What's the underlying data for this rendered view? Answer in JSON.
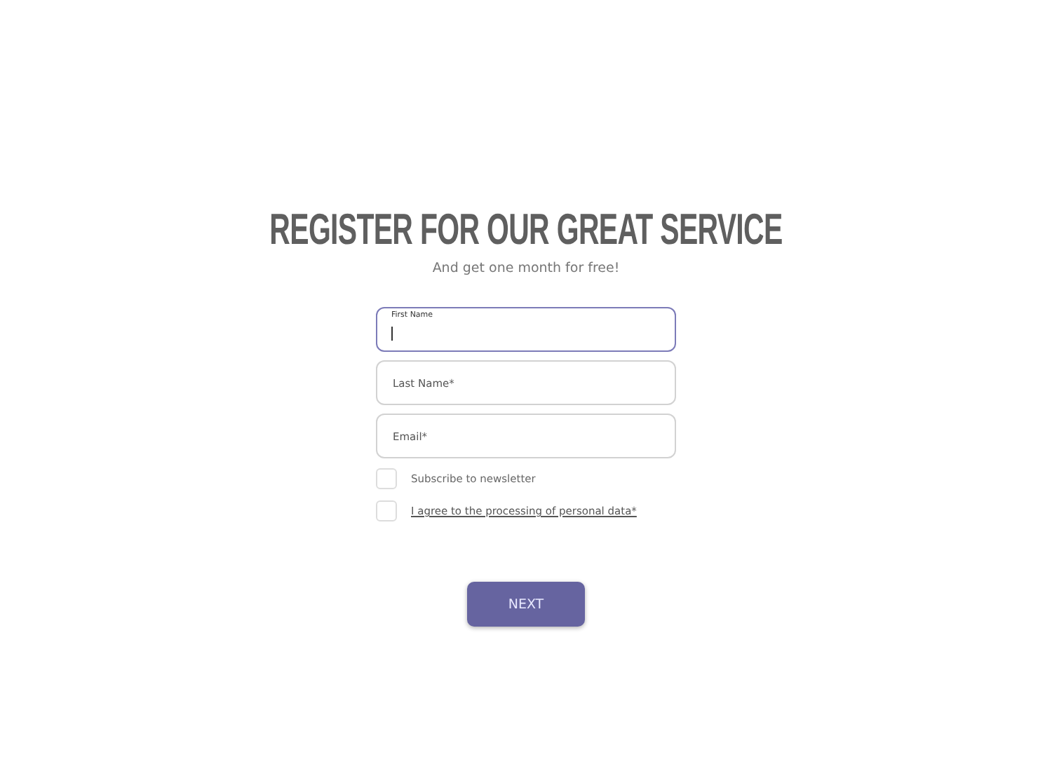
{
  "title": "REGISTER FOR OUR GREAT SERVICE",
  "subtitle": "And get one month for free!",
  "fields": [
    {
      "placeholder": "First Name",
      "focused": true
    },
    {
      "placeholder": "Last Name*",
      "focused": false
    },
    {
      "placeholder": "Email*",
      "focused": false
    }
  ],
  "checkboxes": [
    {
      "label": "Subscribe to newsletter",
      "checked": false,
      "kind": "text"
    },
    {
      "label": "I agree to the processing of personal data*",
      "checked": false,
      "kind": "link"
    }
  ],
  "button": "NEXT"
}
